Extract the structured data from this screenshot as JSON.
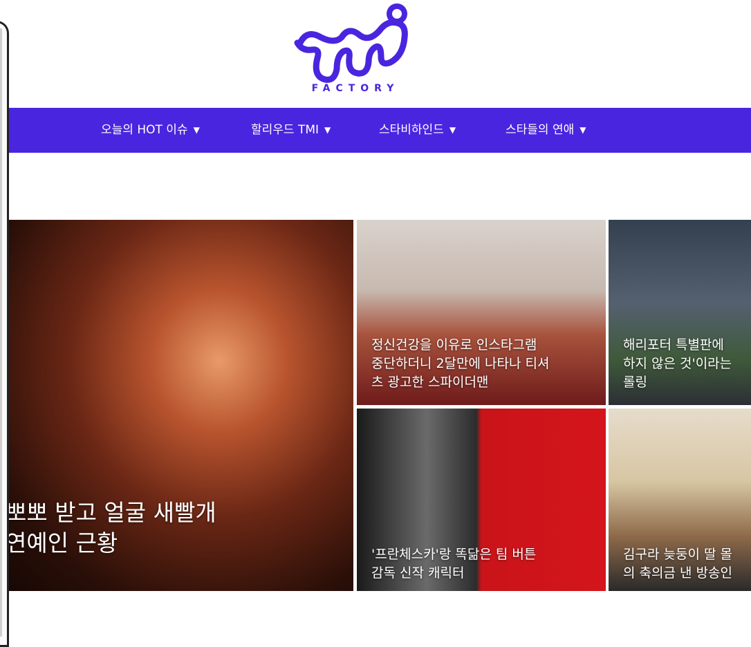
{
  "header": {
    "logo_main": "tmi",
    "logo_sub": "FACTORY"
  },
  "nav": {
    "items": [
      {
        "label": "오늘의 HOT 이슈",
        "icon": "chevron-down-icon"
      },
      {
        "label": "할리우드 TMI",
        "icon": "chevron-down-icon"
      },
      {
        "label": "스타비하인드",
        "icon": "chevron-down-icon"
      },
      {
        "label": "스타들의 연애",
        "icon": "chevron-down-icon"
      }
    ]
  },
  "colors": {
    "brand": "#4a25df",
    "white": "#ffffff"
  },
  "articles": [
    {
      "title": "뽀뽀 받고 얼굴 새빨개\n연예인 근황"
    },
    {
      "title": "정신건강을 이유로 인스타그램\n중단하더니 2달만에 나타나 티셔\n츠 광고한 스파이더맨"
    },
    {
      "title": "해리포터 특별판에\n하지 않은 것'이라는\n롤링"
    },
    {
      "title": "'프란체스카'랑 똑닮은 팀 버튼\n감독 신작 캐릭터"
    },
    {
      "title": "김구라 늦둥이 딸 몰\n의 축의금 낸 방송인"
    }
  ]
}
